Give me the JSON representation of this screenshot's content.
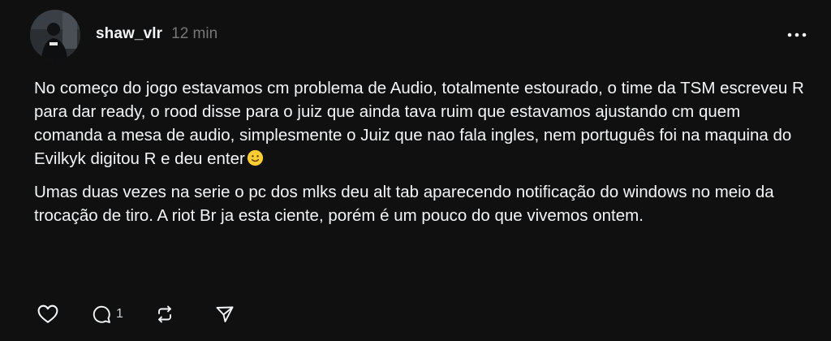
{
  "post": {
    "author": {
      "username": "shaw_vlr",
      "avatar_icon": "profile-photo"
    },
    "timestamp": "12 min",
    "paragraphs": [
      "No começo do jogo estavamos cm problema de Audio, totalmente estourado, o time da TSM escreveu R para dar ready, o rood disse para o juiz que ainda tava ruim que estavamos ajustando cm quem comanda a mesa de audio, simplesmente o Juiz que nao fala ingles, nem português foi na maquina do Evilkyk digitou R e deu enter",
      "Umas duas vezes na serie o pc dos mlks deu alt tab aparecendo notificação do windows no meio da trocação de tiro. A riot Br ja esta ciente, porém é um pouco do que vivemos ontem."
    ],
    "emoji": "slightly-smiling-face",
    "actions": {
      "like_icon": "heart-icon",
      "reply_icon": "comment-icon",
      "reply_count": "1",
      "repost_icon": "repost-icon",
      "share_icon": "send-icon",
      "more_icon": "more-icon"
    }
  },
  "colors": {
    "background": "#101010",
    "primary_text": "#f3f5f7",
    "secondary_text": "#777777",
    "icon": "#f3f5f7",
    "emoji": "#ffcc33"
  }
}
